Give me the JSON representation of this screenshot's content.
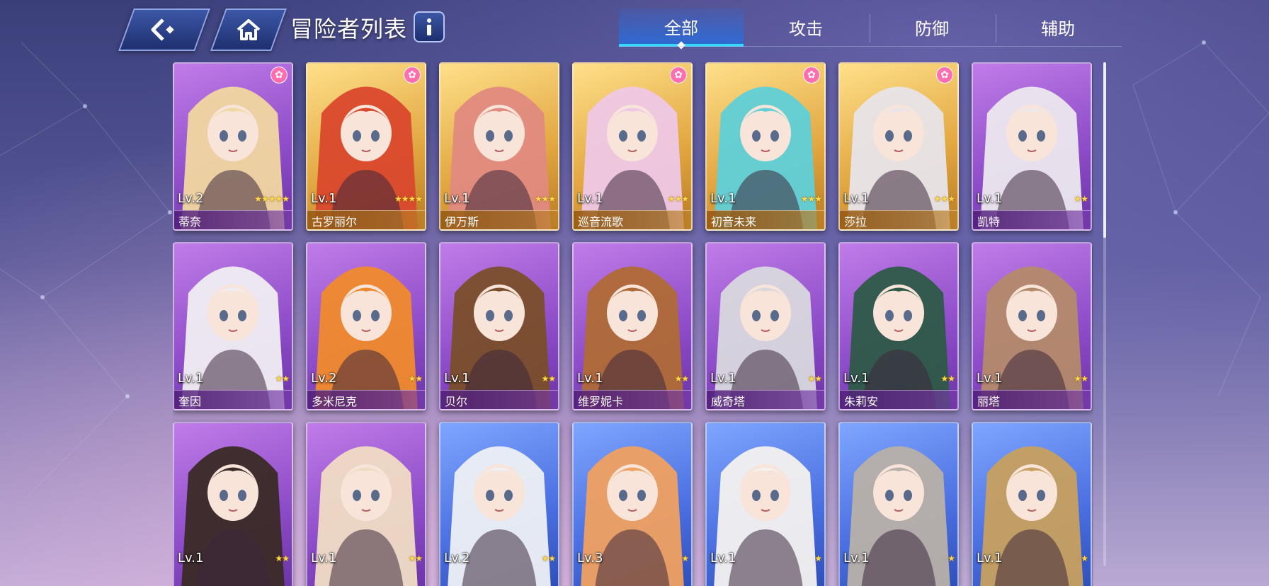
{
  "header": {
    "title": "冒险者列表"
  },
  "tabs": [
    {
      "label": "全部",
      "active": true
    },
    {
      "label": "攻击",
      "active": false
    },
    {
      "label": "防御",
      "active": false
    },
    {
      "label": "辅助",
      "active": false
    }
  ],
  "colors": {
    "tab_active_underline": "#38d7ff",
    "card_purple": "#a664d6",
    "card_gold": "#e1a640",
    "card_blue": "#4b6fe0",
    "star": "#ffd84a",
    "paw_badge": "#ff6fb0"
  },
  "icons": {
    "back": "back-arrow-icon",
    "home": "home-icon",
    "info": "info-icon",
    "badge": "paw-icon",
    "rating": "star-icon"
  },
  "adventurers": [
    {
      "level": "Lv.2",
      "name": "蒂奈",
      "stars": 5,
      "frame": "purple",
      "paw": true,
      "hair": "#f1d7a0"
    },
    {
      "level": "Lv.1",
      "name": "古罗丽尔",
      "stars": 4,
      "frame": "gold",
      "paw": true,
      "hair": "#d9482c"
    },
    {
      "level": "Lv.1",
      "name": "伊万斯",
      "stars": 3,
      "frame": "gold",
      "paw": false,
      "hair": "#e08a80"
    },
    {
      "level": "Lv.1",
      "name": "巡音流歌",
      "stars": 3,
      "frame": "gold",
      "paw": true,
      "hair": "#eec8e6"
    },
    {
      "level": "Lv.1",
      "name": "初音未来",
      "stars": 3,
      "frame": "gold",
      "paw": true,
      "hair": "#5fd0d8"
    },
    {
      "level": "Lv.1",
      "name": "莎拉",
      "stars": 3,
      "frame": "gold",
      "paw": true,
      "hair": "#e8e4ea"
    },
    {
      "level": "Lv.1",
      "name": "凯特",
      "stars": 2,
      "frame": "purple",
      "paw": false,
      "hair": "#ece8ee"
    },
    {
      "level": "Lv.1",
      "name": "奎因",
      "stars": 2,
      "frame": "purple",
      "paw": false,
      "hair": "#f0eef2"
    },
    {
      "level": "Lv.2",
      "name": "多米尼克",
      "stars": 2,
      "frame": "purple",
      "paw": false,
      "hair": "#f08a2c"
    },
    {
      "level": "Lv.1",
      "name": "贝尔",
      "stars": 2,
      "frame": "purple",
      "paw": false,
      "hair": "#7a4e2a"
    },
    {
      "level": "Lv.1",
      "name": "维罗妮卡",
      "stars": 2,
      "frame": "purple",
      "paw": false,
      "hair": "#b06a36"
    },
    {
      "level": "Lv.1",
      "name": "威奇塔",
      "stars": 2,
      "frame": "purple",
      "paw": false,
      "hair": "#d8d8de"
    },
    {
      "level": "Lv.1",
      "name": "朱莉安",
      "stars": 2,
      "frame": "purple",
      "paw": false,
      "hair": "#2e5a48"
    },
    {
      "level": "Lv.1",
      "name": "丽塔",
      "stars": 2,
      "frame": "purple",
      "paw": false,
      "hair": "#b48a6a"
    },
    {
      "level": "Lv.1",
      "name": "",
      "stars": 2,
      "frame": "purple",
      "paw": false,
      "hair": "#3a2a26"
    },
    {
      "level": "Lv.1",
      "name": "",
      "stars": 2,
      "frame": "purple",
      "paw": false,
      "hair": "#f0dcc4"
    },
    {
      "level": "Lv.2",
      "name": "",
      "stars": 2,
      "frame": "blue",
      "paw": false,
      "hair": "#eef0f4"
    },
    {
      "level": "Lv.3",
      "name": "",
      "stars": 1,
      "frame": "blue",
      "paw": false,
      "hair": "#f0a060"
    },
    {
      "level": "Lv.1",
      "name": "",
      "stars": 1,
      "frame": "blue",
      "paw": false,
      "hair": "#f4f2f0"
    },
    {
      "level": "Lv.1",
      "name": "",
      "stars": 1,
      "frame": "blue",
      "paw": false,
      "hair": "#b8b0a8"
    },
    {
      "level": "Lv.1",
      "name": "",
      "stars": 1,
      "frame": "blue",
      "paw": false,
      "hair": "#c8a060"
    }
  ]
}
